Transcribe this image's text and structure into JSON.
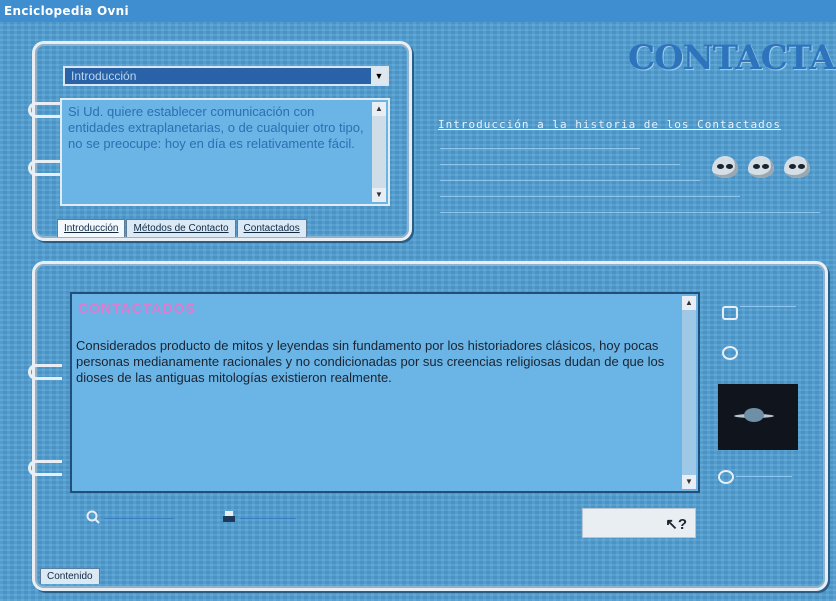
{
  "window": {
    "title": "Enciclopedia Ovni"
  },
  "brand": {
    "title": "CONTACTADOS"
  },
  "intro": {
    "select_value": "Introducción",
    "text": "Si Ud. quiere establecer comunicación con entidades extraplanetarias, o de cualquier otro tipo, no se preocupe: hoy en día es relativamente fácil."
  },
  "tabs": [
    {
      "label": "Introducción"
    },
    {
      "label": "Métodos de Contacto"
    },
    {
      "label": "Contactados"
    }
  ],
  "right_panel": {
    "heading": "Introducción a la historia de los Contactados"
  },
  "content": {
    "title": "CONTACTADOS",
    "text": "Considerados producto de mitos y leyendas sin fundamento por los historiadores clásicos, hoy pocas personas medianamente racionales y no condicionadas por sus creencias religiosas dudan de que los dioses de las antiguas mitologías existieron realmente."
  },
  "bottom_tab": {
    "label": "Contenido"
  },
  "colors": {
    "background": "#4f9ed3",
    "panel": "#6ab4e6",
    "title_pink": "#e07ad0"
  }
}
